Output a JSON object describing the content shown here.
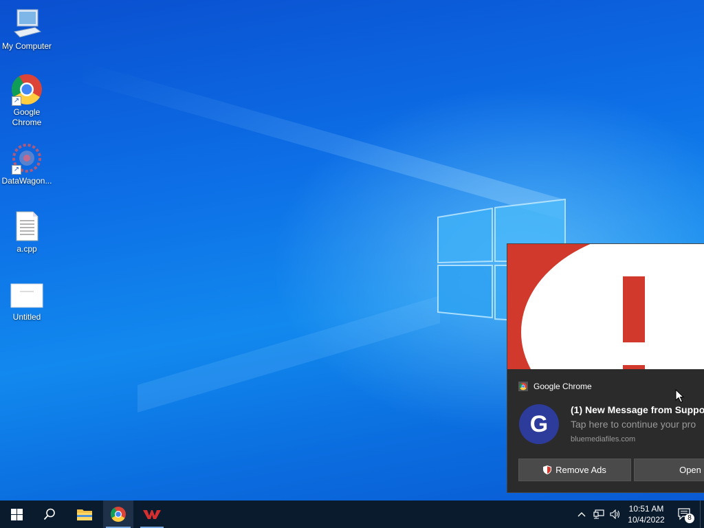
{
  "desktop": {
    "icons": [
      {
        "label": "My Computer"
      },
      {
        "label": "Google\nChrome"
      },
      {
        "label": "DataWagon..."
      },
      {
        "label": "a.cpp"
      },
      {
        "label": "Untitled"
      }
    ]
  },
  "notification": {
    "app_name": "Google Chrome",
    "avatar_letter": "G",
    "title": "(1) New Message from Suppo",
    "body": "Tap here to continue your pro",
    "source": "bluemediafiles.com",
    "buttons": {
      "remove_ads": "Remove Ads",
      "open": "Open"
    },
    "hero_accent": "#d0392b"
  },
  "taskbar": {
    "time": "10:51 AM",
    "date": "10/4/2022",
    "notification_count": "8",
    "background": "#0b1b2e"
  }
}
